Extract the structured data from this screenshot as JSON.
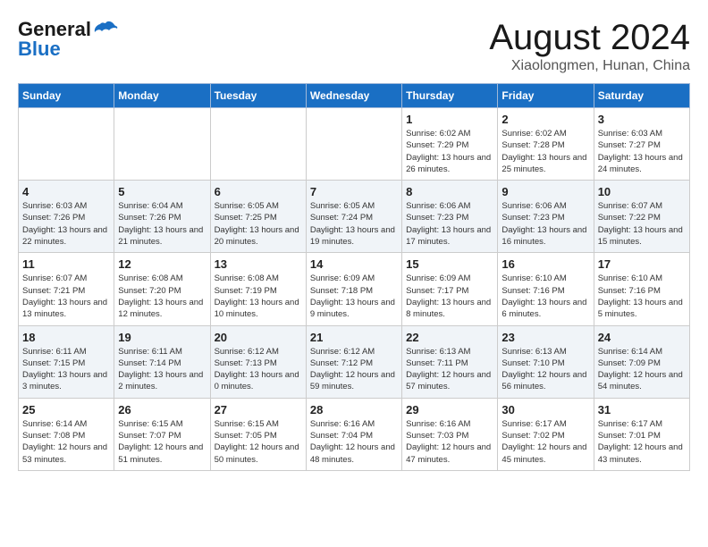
{
  "logo": {
    "line1": "General",
    "line2": "Blue"
  },
  "title": "August 2024",
  "subtitle": "Xiaolongmen, Hunan, China",
  "days_of_week": [
    "Sunday",
    "Monday",
    "Tuesday",
    "Wednesday",
    "Thursday",
    "Friday",
    "Saturday"
  ],
  "weeks": [
    [
      {
        "day": "",
        "info": ""
      },
      {
        "day": "",
        "info": ""
      },
      {
        "day": "",
        "info": ""
      },
      {
        "day": "",
        "info": ""
      },
      {
        "day": "1",
        "info": "Sunrise: 6:02 AM\nSunset: 7:29 PM\nDaylight: 13 hours and 26 minutes."
      },
      {
        "day": "2",
        "info": "Sunrise: 6:02 AM\nSunset: 7:28 PM\nDaylight: 13 hours and 25 minutes."
      },
      {
        "day": "3",
        "info": "Sunrise: 6:03 AM\nSunset: 7:27 PM\nDaylight: 13 hours and 24 minutes."
      }
    ],
    [
      {
        "day": "4",
        "info": "Sunrise: 6:03 AM\nSunset: 7:26 PM\nDaylight: 13 hours and 22 minutes."
      },
      {
        "day": "5",
        "info": "Sunrise: 6:04 AM\nSunset: 7:26 PM\nDaylight: 13 hours and 21 minutes."
      },
      {
        "day": "6",
        "info": "Sunrise: 6:05 AM\nSunset: 7:25 PM\nDaylight: 13 hours and 20 minutes."
      },
      {
        "day": "7",
        "info": "Sunrise: 6:05 AM\nSunset: 7:24 PM\nDaylight: 13 hours and 19 minutes."
      },
      {
        "day": "8",
        "info": "Sunrise: 6:06 AM\nSunset: 7:23 PM\nDaylight: 13 hours and 17 minutes."
      },
      {
        "day": "9",
        "info": "Sunrise: 6:06 AM\nSunset: 7:23 PM\nDaylight: 13 hours and 16 minutes."
      },
      {
        "day": "10",
        "info": "Sunrise: 6:07 AM\nSunset: 7:22 PM\nDaylight: 13 hours and 15 minutes."
      }
    ],
    [
      {
        "day": "11",
        "info": "Sunrise: 6:07 AM\nSunset: 7:21 PM\nDaylight: 13 hours and 13 minutes."
      },
      {
        "day": "12",
        "info": "Sunrise: 6:08 AM\nSunset: 7:20 PM\nDaylight: 13 hours and 12 minutes."
      },
      {
        "day": "13",
        "info": "Sunrise: 6:08 AM\nSunset: 7:19 PM\nDaylight: 13 hours and 10 minutes."
      },
      {
        "day": "14",
        "info": "Sunrise: 6:09 AM\nSunset: 7:18 PM\nDaylight: 13 hours and 9 minutes."
      },
      {
        "day": "15",
        "info": "Sunrise: 6:09 AM\nSunset: 7:17 PM\nDaylight: 13 hours and 8 minutes."
      },
      {
        "day": "16",
        "info": "Sunrise: 6:10 AM\nSunset: 7:16 PM\nDaylight: 13 hours and 6 minutes."
      },
      {
        "day": "17",
        "info": "Sunrise: 6:10 AM\nSunset: 7:16 PM\nDaylight: 13 hours and 5 minutes."
      }
    ],
    [
      {
        "day": "18",
        "info": "Sunrise: 6:11 AM\nSunset: 7:15 PM\nDaylight: 13 hours and 3 minutes."
      },
      {
        "day": "19",
        "info": "Sunrise: 6:11 AM\nSunset: 7:14 PM\nDaylight: 13 hours and 2 minutes."
      },
      {
        "day": "20",
        "info": "Sunrise: 6:12 AM\nSunset: 7:13 PM\nDaylight: 13 hours and 0 minutes."
      },
      {
        "day": "21",
        "info": "Sunrise: 6:12 AM\nSunset: 7:12 PM\nDaylight: 12 hours and 59 minutes."
      },
      {
        "day": "22",
        "info": "Sunrise: 6:13 AM\nSunset: 7:11 PM\nDaylight: 12 hours and 57 minutes."
      },
      {
        "day": "23",
        "info": "Sunrise: 6:13 AM\nSunset: 7:10 PM\nDaylight: 12 hours and 56 minutes."
      },
      {
        "day": "24",
        "info": "Sunrise: 6:14 AM\nSunset: 7:09 PM\nDaylight: 12 hours and 54 minutes."
      }
    ],
    [
      {
        "day": "25",
        "info": "Sunrise: 6:14 AM\nSunset: 7:08 PM\nDaylight: 12 hours and 53 minutes."
      },
      {
        "day": "26",
        "info": "Sunrise: 6:15 AM\nSunset: 7:07 PM\nDaylight: 12 hours and 51 minutes."
      },
      {
        "day": "27",
        "info": "Sunrise: 6:15 AM\nSunset: 7:05 PM\nDaylight: 12 hours and 50 minutes."
      },
      {
        "day": "28",
        "info": "Sunrise: 6:16 AM\nSunset: 7:04 PM\nDaylight: 12 hours and 48 minutes."
      },
      {
        "day": "29",
        "info": "Sunrise: 6:16 AM\nSunset: 7:03 PM\nDaylight: 12 hours and 47 minutes."
      },
      {
        "day": "30",
        "info": "Sunrise: 6:17 AM\nSunset: 7:02 PM\nDaylight: 12 hours and 45 minutes."
      },
      {
        "day": "31",
        "info": "Sunrise: 6:17 AM\nSunset: 7:01 PM\nDaylight: 12 hours and 43 minutes."
      }
    ]
  ]
}
